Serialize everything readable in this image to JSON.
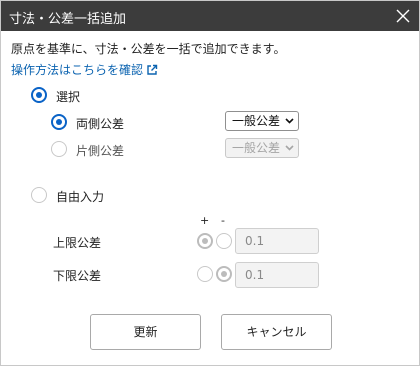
{
  "dialog": {
    "title": "寸法・公差一括追加",
    "description": "原点を基準に、寸法・公差を一括で追加できます。",
    "help_link": "操作方法はこちらを確認"
  },
  "selection": {
    "label": "選択",
    "both_label": "両側公差",
    "both_value": "一般公差",
    "single_label": "片側公差",
    "single_value": "一般公差"
  },
  "free_input": {
    "label": "自由入力",
    "plus_header": "+",
    "minus_header": "-",
    "upper_label": "上限公差",
    "upper_value": "0.1",
    "lower_label": "下限公差",
    "lower_value": "0.1"
  },
  "buttons": {
    "update": "更新",
    "cancel": "キャンセル"
  },
  "colors": {
    "titlebar": "#3c3c3c",
    "accent": "#0a63c7",
    "link": "#0b63b0"
  },
  "icons": [
    "close-icon",
    "external-link-icon",
    "chevron-down-icon"
  ]
}
